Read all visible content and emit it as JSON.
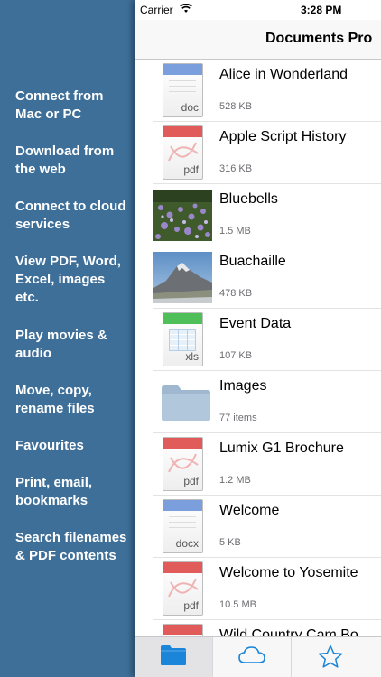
{
  "features": [
    "Connect from Mac or PC",
    "Download from the web",
    "Connect to cloud services",
    "View PDF, Word, Excel, images etc.",
    "Play movies & audio",
    "Move, copy, rename files",
    "Favourites",
    "Print, email, bookmarks",
    "Search filenames & PDF contents"
  ],
  "status": {
    "carrier": "Carrier",
    "time": "3:28 PM"
  },
  "nav": {
    "title": "Documents Pro"
  },
  "files": [
    {
      "name": "Alice in Wonderland",
      "meta": "528 KB",
      "kind": "doc",
      "ext": "doc",
      "color": "#7b9fdc"
    },
    {
      "name": "Apple Script History",
      "meta": "316 KB",
      "kind": "doc",
      "ext": "pdf",
      "color": "#e15b5b"
    },
    {
      "name": "Bluebells",
      "meta": "1.5 MB",
      "kind": "photo-bluebells"
    },
    {
      "name": "Buachaille",
      "meta": "478 KB",
      "kind": "photo-mountain"
    },
    {
      "name": "Event Data",
      "meta": "107 KB",
      "kind": "doc",
      "ext": "xls",
      "color": "#4fbf5a"
    },
    {
      "name": "Images",
      "meta": "77 items",
      "kind": "folder"
    },
    {
      "name": "Lumix G1 Brochure",
      "meta": "1.2 MB",
      "kind": "doc",
      "ext": "pdf",
      "color": "#e15b5b"
    },
    {
      "name": "Welcome",
      "meta": "5 KB",
      "kind": "doc",
      "ext": "docx",
      "color": "#7b9fdc"
    },
    {
      "name": "Welcome to Yosemite",
      "meta": "10.5 MB",
      "kind": "doc",
      "ext": "pdf",
      "color": "#e15b5b"
    },
    {
      "name": "Wild Country Cam Bo",
      "meta": "",
      "kind": "doc",
      "ext": "pdf",
      "color": "#e15b5b"
    }
  ],
  "tabs": [
    {
      "icon": "folder-icon",
      "selected": true
    },
    {
      "icon": "cloud-icon",
      "selected": false
    },
    {
      "icon": "star-icon",
      "selected": false
    }
  ],
  "colors": {
    "side_panel": "#3e6f99",
    "tint": "#1a85d9"
  }
}
